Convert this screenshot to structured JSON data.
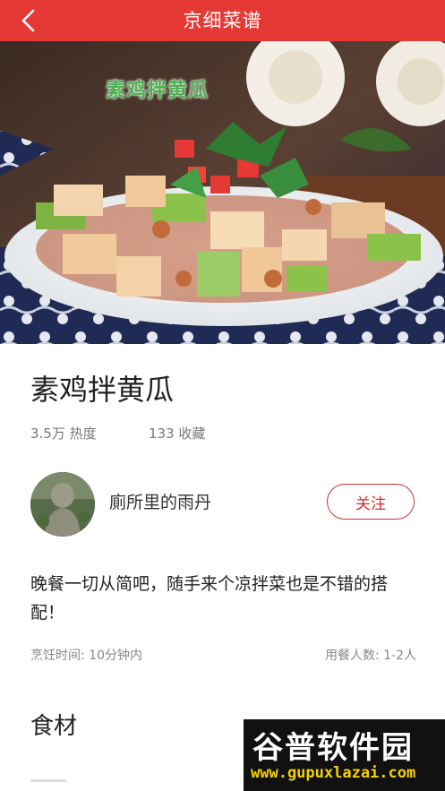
{
  "header": {
    "title": "京细菜谱",
    "back_icon": "chevron-left-icon"
  },
  "hero": {
    "image_caption": "素鸡拌黄瓜"
  },
  "recipe": {
    "title": "素鸡拌黄瓜",
    "heat_value": "3.5万",
    "heat_label": "热度",
    "favorites_value": "133",
    "favorites_label": "收藏",
    "description": "晚餐一切从简吧，随手来个凉拌菜也是不错的搭配！",
    "cook_time_label": "烹饪时间:",
    "cook_time_value": "10分钟内",
    "servings_label": "用餐人数:",
    "servings_value": "1-2人"
  },
  "author": {
    "name": "廁所里的雨丹",
    "follow_label": "关注"
  },
  "ingredients": {
    "section_title": "食材"
  },
  "watermark": {
    "main": "谷普软件园",
    "url": "www.gupuxlazai.com"
  },
  "colors": {
    "accent": "#e53935",
    "follow": "#d32f2f"
  }
}
